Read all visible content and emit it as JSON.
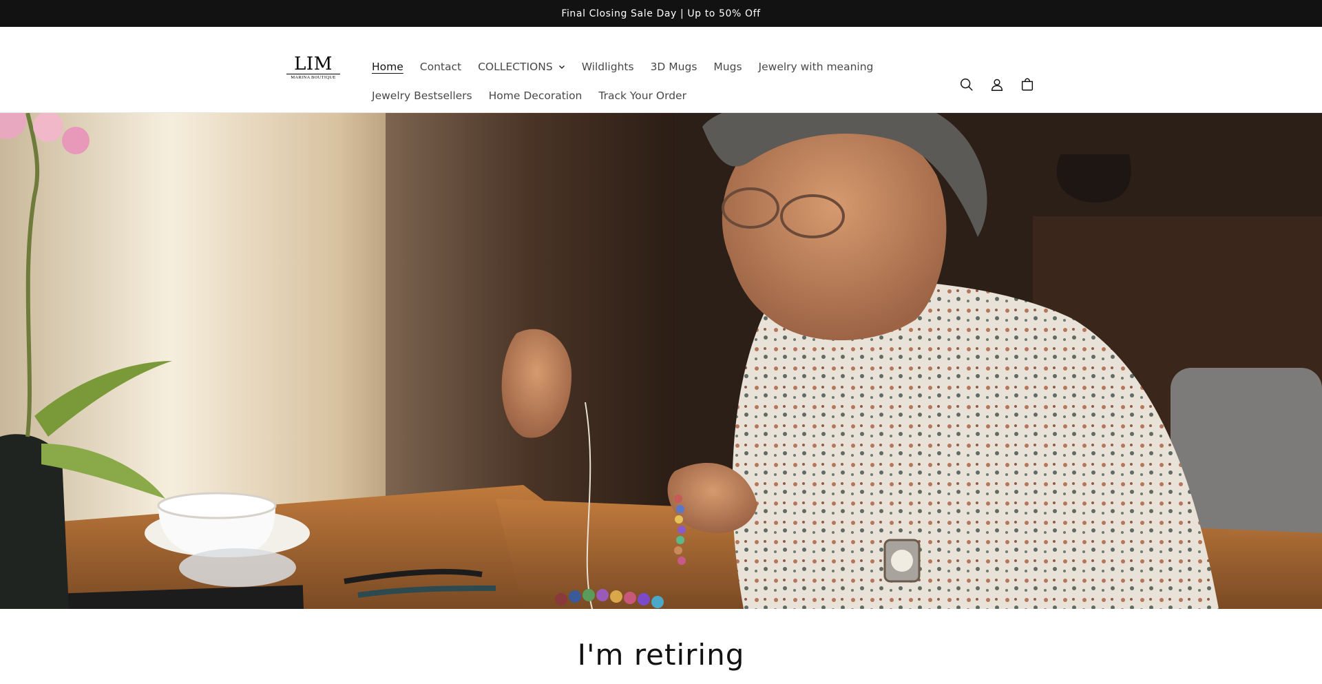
{
  "announcement": {
    "text": "Final Closing Sale Day | Up to 50% Off"
  },
  "logo": {
    "main": "LIM",
    "sub": "MARINA BOUTIQUE"
  },
  "nav": {
    "row1": [
      {
        "label": "Home",
        "active": true
      },
      {
        "label": "Contact"
      },
      {
        "label": "COLLECTIONS",
        "dropdown": true
      },
      {
        "label": "Wildlights"
      },
      {
        "label": "3D Mugs"
      },
      {
        "label": "Mugs"
      },
      {
        "label": "Jewelry with meaning"
      }
    ],
    "row2": [
      {
        "label": "Jewelry Bestsellers"
      },
      {
        "label": "Home Decoration"
      },
      {
        "label": "Track Your Order"
      }
    ]
  },
  "header_icons": [
    "search-icon",
    "account-icon",
    "cart-icon"
  ],
  "hero": {
    "image": "photo of an older woman stringing a beaded bracelet at a wooden table beside a window, with an orchid, a teacup and a bead tray"
  },
  "main": {
    "heading": "I'm retiring"
  },
  "colors": {
    "announcement_bg": "#121212",
    "text": "#121212",
    "background": "#ffffff"
  }
}
